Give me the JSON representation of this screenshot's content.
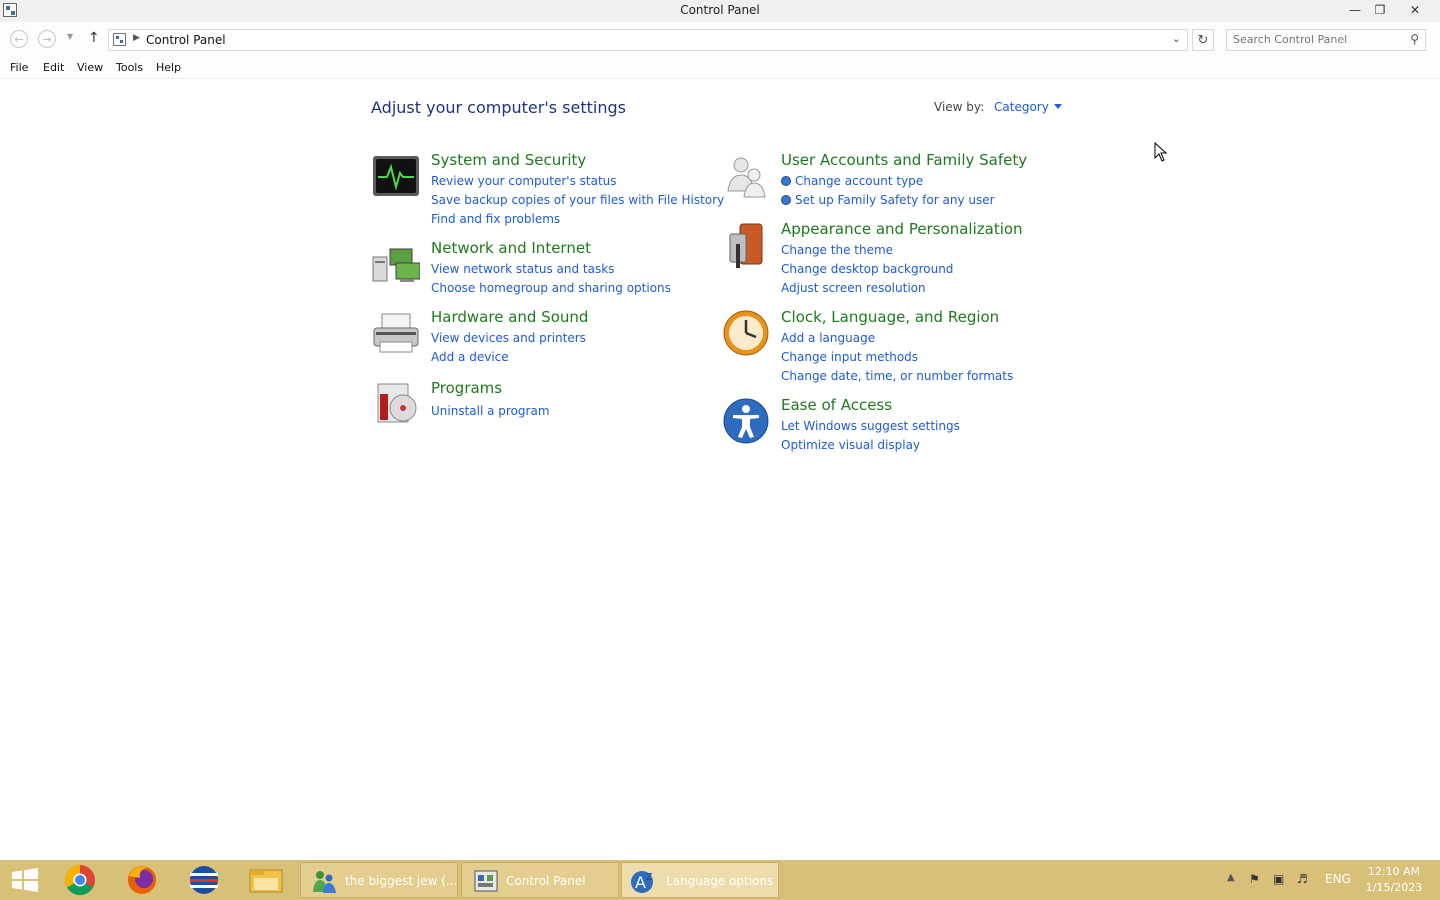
{
  "window": {
    "title": "Control Panel"
  },
  "navigation": {
    "breadcrumb": "Control Panel",
    "search_placeholder": "Search Control Panel"
  },
  "menu": {
    "items": [
      "File",
      "Edit",
      "View",
      "Tools",
      "Help"
    ]
  },
  "content": {
    "heading": "Adjust your computer's settings",
    "view_by_label": "View by:",
    "view_by_value": "Category",
    "categories": [
      {
        "title": "System and Security",
        "links": [
          "Review your computer's status",
          "Save backup copies of your files with File History",
          "Find and fix problems"
        ]
      },
      {
        "title": "Network and Internet",
        "links": [
          "View network status and tasks",
          "Choose homegroup and sharing options"
        ]
      },
      {
        "title": "Hardware and Sound",
        "links": [
          "View devices and printers",
          "Add a device"
        ]
      },
      {
        "title": "Programs",
        "links": [
          "Uninstall a program"
        ]
      },
      {
        "title": "User Accounts and Family Safety",
        "links": [
          "Change account type",
          "Set up Family Safety for any user"
        ]
      },
      {
        "title": "Appearance and Personalization",
        "links": [
          "Change the theme",
          "Change desktop background",
          "Adjust screen resolution"
        ]
      },
      {
        "title": "Clock, Language, and Region",
        "links": [
          "Add a language",
          "Change input methods",
          "Change date, time, or number formats"
        ]
      },
      {
        "title": "Ease of Access",
        "links": [
          "Let Windows suggest settings",
          "Optimize visual display"
        ]
      }
    ]
  },
  "taskbar": {
    "buttons": [
      {
        "label": "the biggest jew (...",
        "icon": "people-icon"
      },
      {
        "label": "Control Panel",
        "icon": "control-panel-icon"
      },
      {
        "label": "Language options",
        "icon": "language-icon"
      }
    ],
    "pinned": [
      "start-icon",
      "chrome-icon",
      "firefox-icon",
      "opera-icon",
      "file-explorer-icon"
    ],
    "tray": {
      "language": "ENG",
      "time": "12:10 AM",
      "date": "1/15/2023"
    }
  },
  "colors": {
    "link": "#1e5bd8",
    "category_title": "#1e7a1e",
    "heading": "#1e3287",
    "taskbar": "#d8c079"
  }
}
